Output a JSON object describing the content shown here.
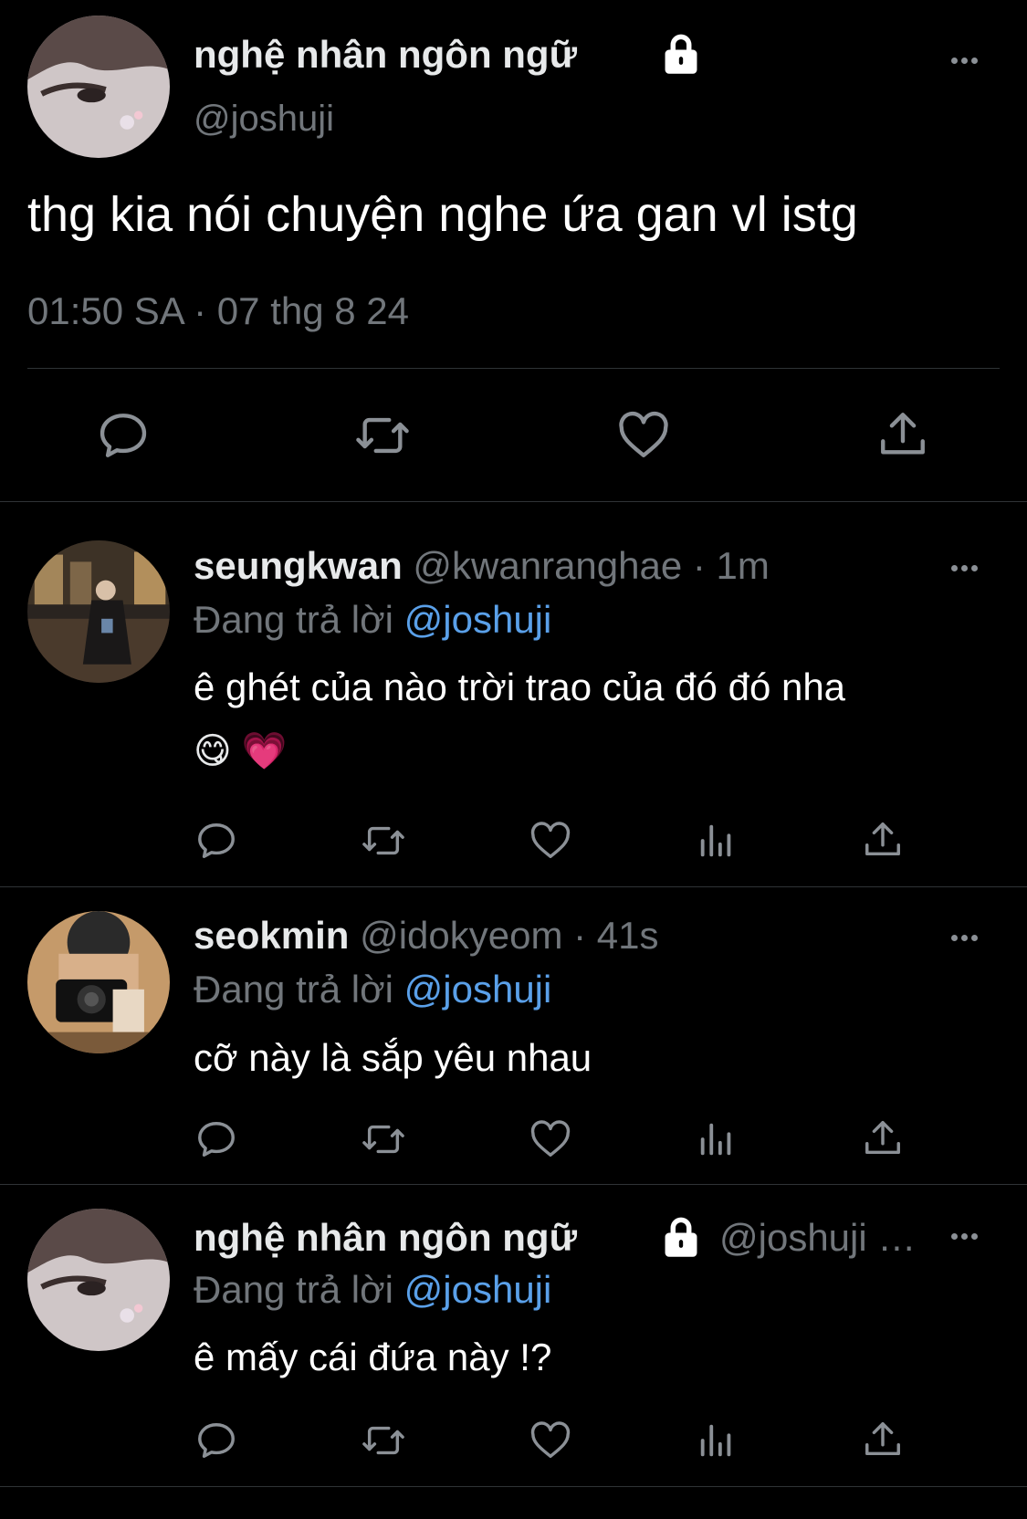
{
  "main_tweet": {
    "display_name": "nghệ nhân ngôn ngữ",
    "handle": "@joshuji",
    "text": "thg kia nói chuyện nghe ứa gan vl istg",
    "timestamp": "01:50 SA · 07 thg 8 24",
    "icons": [
      "reply-icon",
      "retweet-icon",
      "like-icon",
      "share-icon"
    ]
  },
  "replies": [
    {
      "display_name": "seungkwan",
      "handle_meta": "@kwanranghae · 1m",
      "replying_prefix": "Đang trả lời",
      "replying_to": "@joshuji",
      "text_line1": "ê ghét của nào trời trao của đó đó nha",
      "text_line2": "😋 💗"
    },
    {
      "display_name": "seokmin",
      "handle_meta": "@idokyeom · 41s",
      "replying_prefix": "Đang trả lời",
      "replying_to": "@joshuji",
      "text_line1": "cỡ này là sắp yêu nhau"
    },
    {
      "display_name": "nghệ nhân ngôn ngữ",
      "handle_meta": "@joshuji …",
      "replying_prefix": "Đang trả lời",
      "replying_to": "@joshuji",
      "text_line1": "ê mấy cái đứa này !?"
    }
  ],
  "colors": {
    "background": "#000000",
    "text": "#e7e9ea",
    "muted": "#71767b",
    "link": "#5aa0e9",
    "divider": "#2f3336"
  }
}
